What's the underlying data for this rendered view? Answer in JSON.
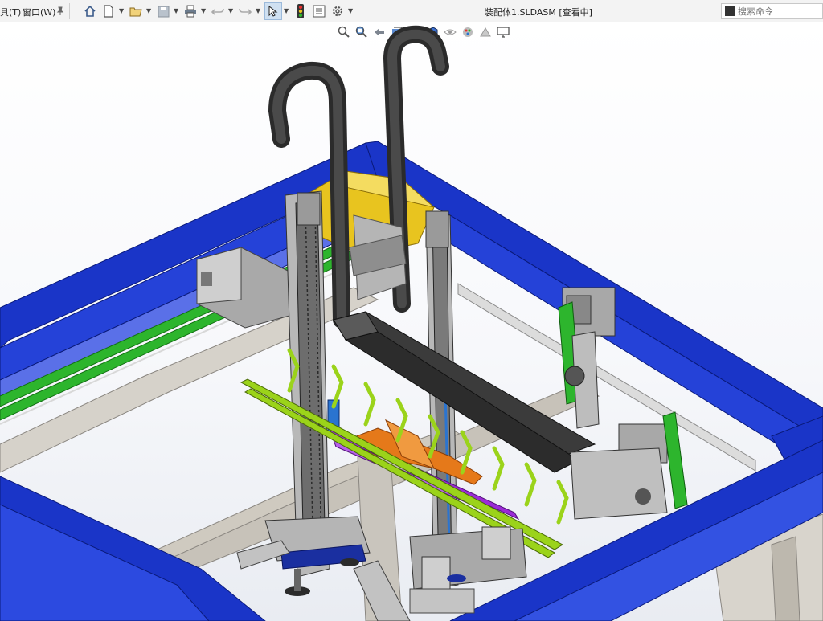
{
  "menu": {
    "tools": "具(T)",
    "window": "窗口(W)"
  },
  "document": {
    "title": "装配体1.SLDASM [查看中]"
  },
  "search": {
    "placeholder": "搜索命令"
  },
  "colors": {
    "frame_blue": "#1a35c8",
    "rail_green": "#2db52d",
    "bracket_yellowgreen": "#9bd31a",
    "housing_yellow": "#e8c41f",
    "orange": "#e5791a",
    "purple": "#9b2bd6",
    "dark_gray": "#3b3b3b",
    "light_gray": "#c9c9c9"
  }
}
